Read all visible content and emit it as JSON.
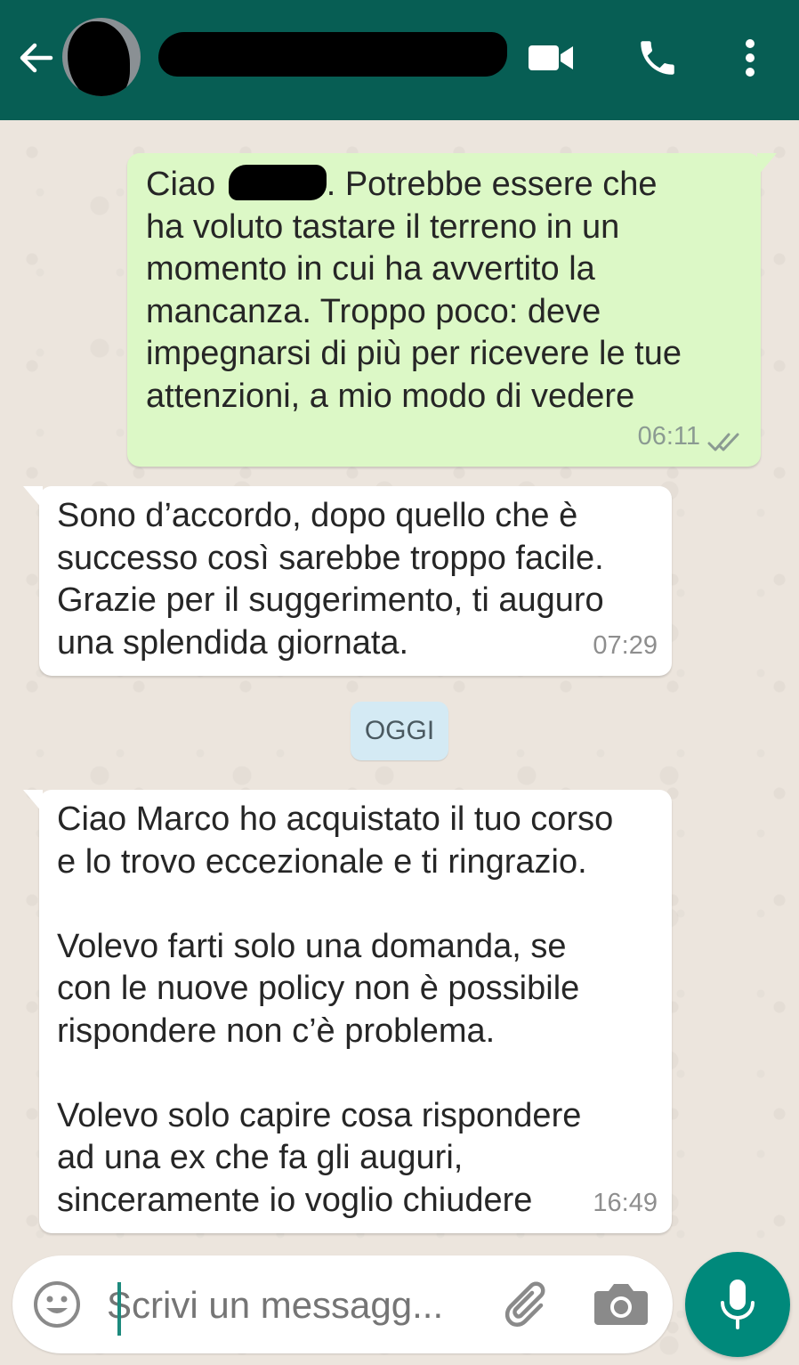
{
  "header": {
    "back_icon": "arrow-left-icon",
    "contact_name": "",
    "actions": [
      {
        "icon": "video-call-icon"
      },
      {
        "icon": "phone-icon"
      },
      {
        "icon": "more-vert-icon"
      }
    ],
    "color": "#075e54"
  },
  "messages": [
    {
      "direction": "outgoing",
      "text_before_redaction": "Ciao ",
      "text_after_redaction": ". Potrebbe essere che\nha voluto tastare il terreno in un\nmomento in cui ha avvertito la\nmancanza. Troppo poco: deve\nimpegnarsi di più per ricevere le tue\nattenzioni, a mio modo di vedere",
      "time": "06:11",
      "status_icon": "double-check-icon"
    },
    {
      "direction": "incoming",
      "text": "Sono d’accordo, dopo quello che è\nsuccesso così sarebbe troppo facile.\nGrazie per il suggerimento, ti auguro\nuna splendida giornata.",
      "time": "07:29"
    },
    {
      "direction": "incoming",
      "text": "Ciao Marco ho acquistato il tuo corso\ne lo trovo eccezionale e ti ringrazio.\n\nVolevo farti solo una domanda, se\ncon le nuove policy non è possibile\nrispondere non c’è problema.\n\nVolevo solo capire cosa rispondere\nad una ex che fa gli auguri,\nsinceramente io voglio chiudere",
      "time": "16:49"
    }
  ],
  "date_divider": "OGGI",
  "composer": {
    "placeholder": "Scrivi un messagg...",
    "emoji_icon": "emoji-icon",
    "attach_icon": "paperclip-icon",
    "camera_icon": "camera-icon",
    "mic_icon": "mic-icon"
  },
  "colors": {
    "outgoing_bubble": "#dcf8c6",
    "incoming_bubble": "#ffffff",
    "wallpaper": "#ece5dd",
    "accent": "#00897b"
  }
}
